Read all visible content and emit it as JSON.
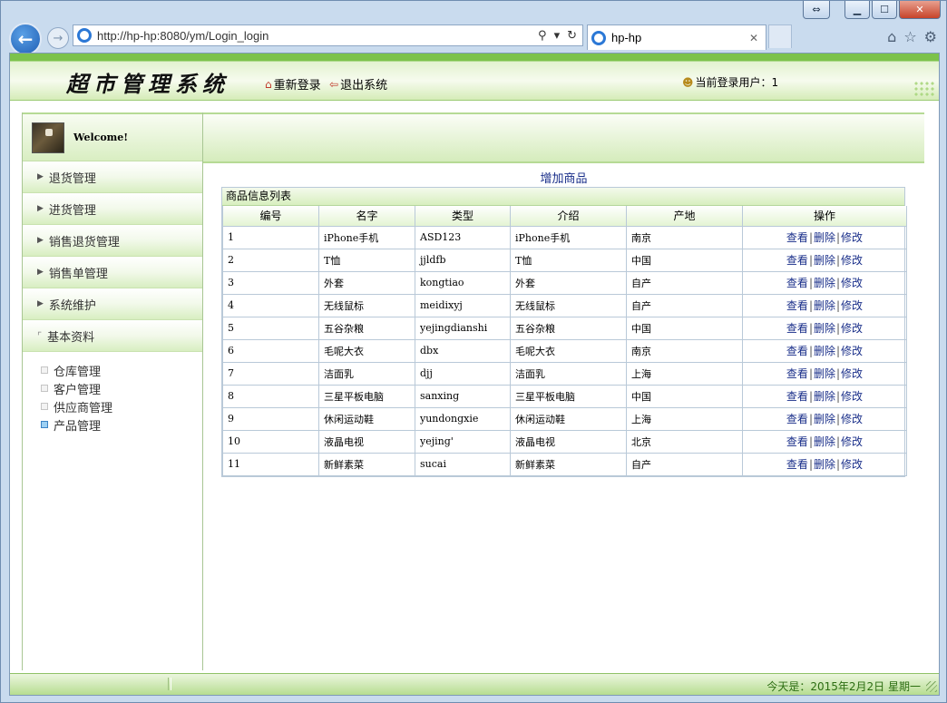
{
  "browser": {
    "url": "http://hp-hp:8080/ym/Login_login",
    "tab_title": "hp-hp"
  },
  "header": {
    "system_title": "超市管理系统",
    "relogin": "重新登录",
    "logout": "退出系统",
    "current_user_label": "当前登录用户：1"
  },
  "sidebar": {
    "welcome": "Welcome!",
    "menus": [
      {
        "label": "退货管理"
      },
      {
        "label": "进货管理"
      },
      {
        "label": "销售退货管理"
      },
      {
        "label": "销售单管理"
      },
      {
        "label": "系统维护"
      },
      {
        "label": "基本资料"
      }
    ],
    "submenu": [
      {
        "label": "仓库管理"
      },
      {
        "label": "客户管理"
      },
      {
        "label": "供应商管理"
      },
      {
        "label": "产品管理"
      }
    ]
  },
  "content": {
    "add_link": "增加商品",
    "table_title": "商品信息列表",
    "columns": [
      "编号",
      "名字",
      "类型",
      "介绍",
      "产地",
      "操作"
    ],
    "ops": {
      "view": "查看",
      "delete": "删除",
      "edit": "修改",
      "sep": "|"
    },
    "rows": [
      [
        "1",
        "iPhone手机",
        "ASD123",
        "iPhone手机",
        "南京"
      ],
      [
        "2",
        "T恤",
        "jjldfb",
        "T恤",
        "中国"
      ],
      [
        "3",
        "外套",
        "kongtiao",
        "外套",
        "自产"
      ],
      [
        "4",
        "无线鼠标",
        "meidixyj",
        "无线鼠标",
        "自产"
      ],
      [
        "5",
        "五谷杂粮",
        "yejingdianshi",
        "五谷杂粮",
        "中国"
      ],
      [
        "6",
        "毛呢大衣",
        "dbx",
        "毛呢大衣",
        "南京"
      ],
      [
        "7",
        "洁面乳",
        "djj",
        "洁面乳",
        "上海"
      ],
      [
        "8",
        "三星平板电脑",
        "sanxing",
        "三星平板电脑",
        "中国"
      ],
      [
        "9",
        "休闲运动鞋",
        "yundongxie",
        "休闲运动鞋",
        "上海"
      ],
      [
        "10",
        "液晶电视",
        "yejing'",
        "液晶电视",
        "北京"
      ],
      [
        "11",
        "新鲜素菜",
        "sucai",
        "新鲜素菜",
        "自产"
      ]
    ]
  },
  "footer": {
    "date": "今天是：2015年2月2日 星期一"
  }
}
